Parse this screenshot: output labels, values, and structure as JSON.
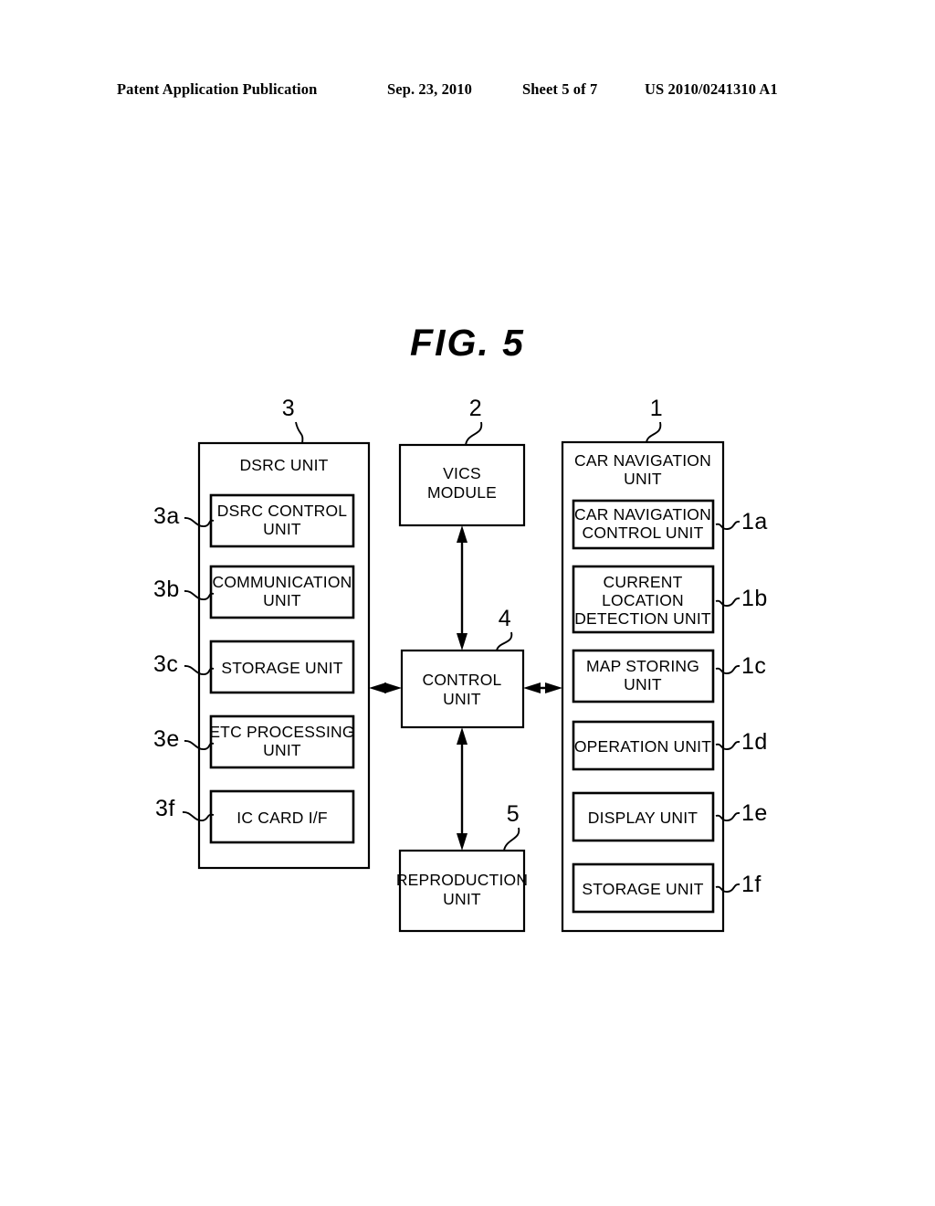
{
  "header": {
    "publication": "Patent Application Publication",
    "date": "Sep. 23, 2010",
    "sheet": "Sheet 5 of 7",
    "patent_number": "US 2010/0241310 A1"
  },
  "figure": {
    "title": "FIG.  5"
  },
  "diagram": {
    "left_group": {
      "ref": "3",
      "title_line1": "DSRC UNIT",
      "blocks": [
        {
          "ref": "3a",
          "line1": "DSRC CONTROL",
          "line2": "UNIT"
        },
        {
          "ref": "3b",
          "line1": "COMMUNICATION",
          "line2": "UNIT"
        },
        {
          "ref": "3c",
          "line1": "STORAGE UNIT",
          "line2": ""
        },
        {
          "ref": "3e",
          "line1": "ETC PROCESSING",
          "line2": "UNIT"
        },
        {
          "ref": "3f",
          "line1": "IC CARD I/F",
          "line2": ""
        }
      ]
    },
    "center_group": {
      "vics": {
        "ref": "2",
        "line1": "VICS",
        "line2": "MODULE"
      },
      "control": {
        "ref": "4",
        "line1": "CONTROL",
        "line2": "UNIT"
      },
      "reproduction": {
        "ref": "5",
        "line1": "REPRODUCTION",
        "line2": "UNIT"
      }
    },
    "right_group": {
      "ref": "1",
      "title_line1": "CAR NAVIGATION",
      "title_line2": "UNIT",
      "blocks": [
        {
          "ref": "1a",
          "line1": "CAR NAVIGATION",
          "line2": "CONTROL UNIT",
          "line3": ""
        },
        {
          "ref": "1b",
          "line1": "CURRENT",
          "line2": "LOCATION",
          "line3": "DETECTION UNIT"
        },
        {
          "ref": "1c",
          "line1": "MAP STORING",
          "line2": "UNIT",
          "line3": ""
        },
        {
          "ref": "1d",
          "line1": "OPERATION UNIT",
          "line2": "",
          "line3": ""
        },
        {
          "ref": "1e",
          "line1": "DISPLAY UNIT",
          "line2": "",
          "line3": ""
        },
        {
          "ref": "1f",
          "line1": "STORAGE UNIT",
          "line2": "",
          "line3": ""
        }
      ]
    }
  }
}
